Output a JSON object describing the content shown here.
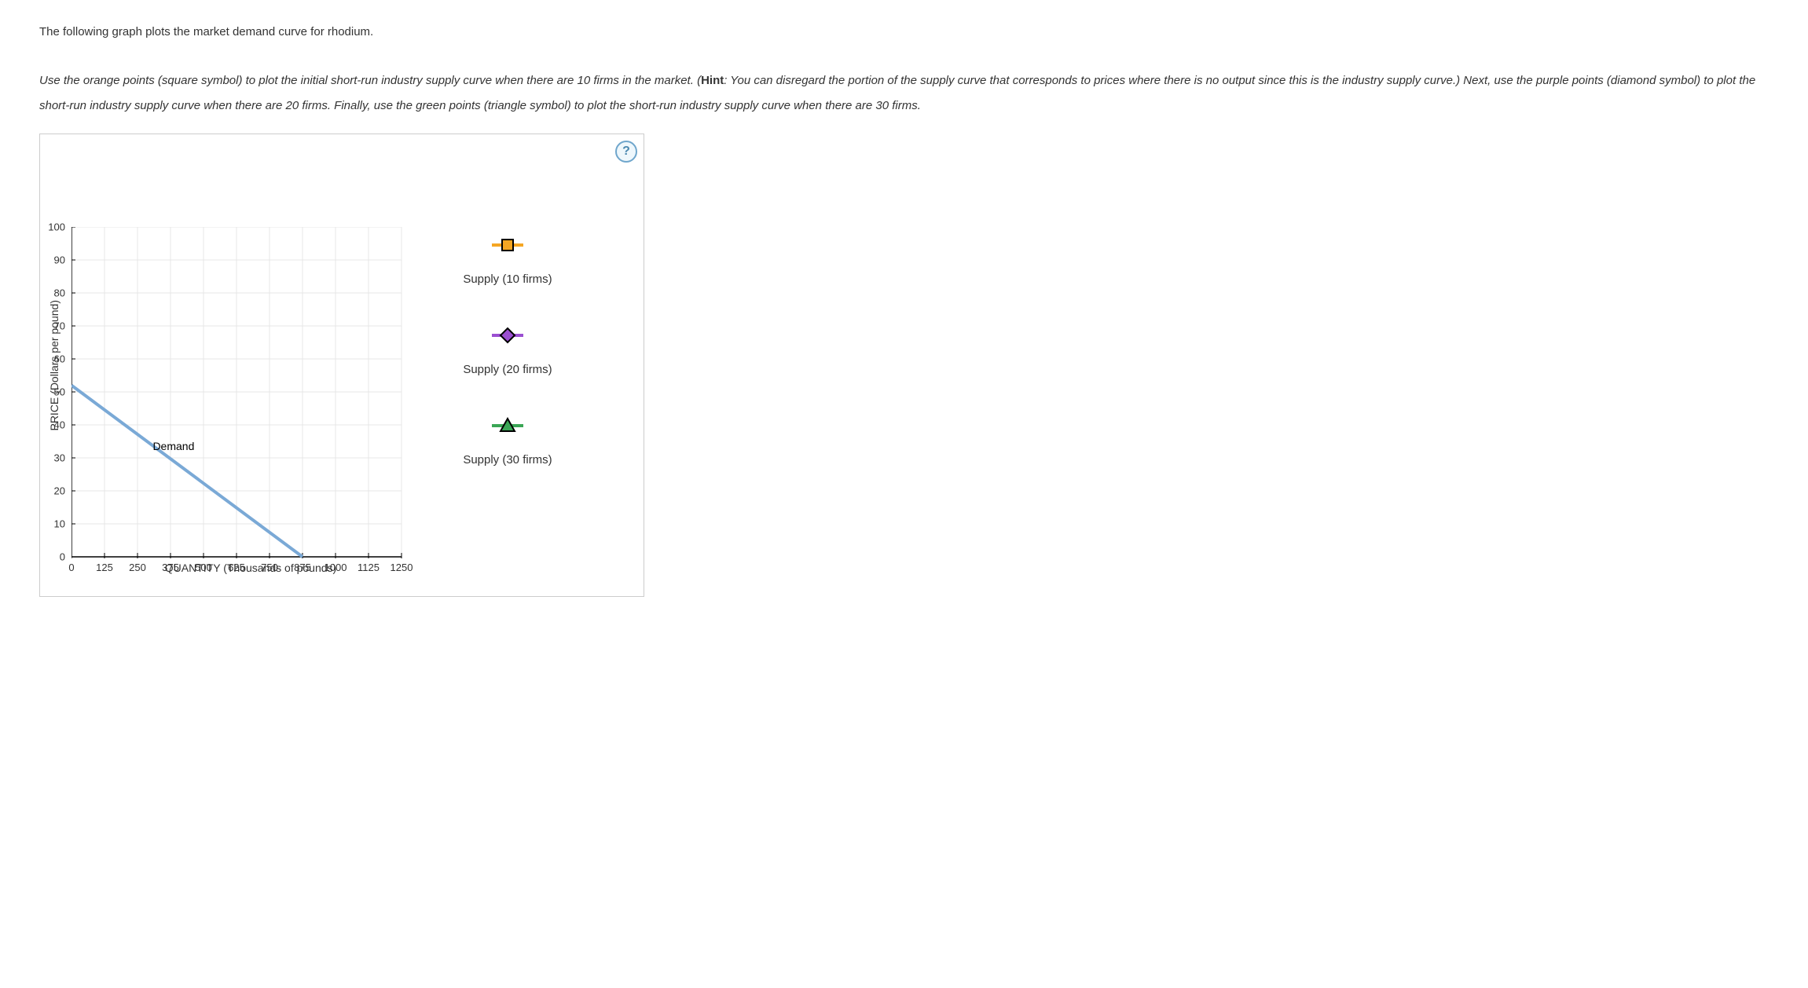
{
  "intro": "The following graph plots the market demand curve for rhodium.",
  "instructions_parts": {
    "p1": "Use the orange points (square symbol) to plot the initial short-run industry supply curve when there are 10 firms in the market. (",
    "hint_label": "Hint",
    "p2": ": You can disregard the portion of the supply curve that corresponds to prices where there is no output since this is the industry supply curve.) Next, use the purple points (diamond symbol) to plot the short-run industry supply curve when there are 20 firms. Finally, use the green points (triangle symbol) to plot the short-run industry supply curve when there are 30 firms."
  },
  "help_label": "?",
  "chart_data": {
    "type": "line",
    "title": "",
    "xlabel": "QUANTITY (Thousands of pounds)",
    "ylabel": "PRICE (Dollars per pound)",
    "x_ticks": [
      0,
      125,
      250,
      375,
      500,
      625,
      750,
      875,
      1000,
      1125,
      1250
    ],
    "y_ticks": [
      0,
      10,
      20,
      30,
      40,
      50,
      60,
      70,
      80,
      90,
      100
    ],
    "xlim": [
      0,
      1250
    ],
    "ylim": [
      0,
      100
    ],
    "series": [
      {
        "name": "Demand",
        "color": "#7aa9d6",
        "points": [
          {
            "x": 0,
            "y": 52
          },
          {
            "x": 875,
            "y": 0
          }
        ]
      }
    ],
    "demand_label": "Demand",
    "legend_items": [
      {
        "name": "Supply (10 firms)",
        "symbol": "square",
        "color": "#f5a623",
        "stroke": "#000"
      },
      {
        "name": "Supply (20 firms)",
        "symbol": "diamond",
        "color": "#9b4fd1",
        "stroke": "#000"
      },
      {
        "name": "Supply (30 firms)",
        "symbol": "triangle",
        "color": "#3aa655",
        "stroke": "#000"
      }
    ]
  }
}
